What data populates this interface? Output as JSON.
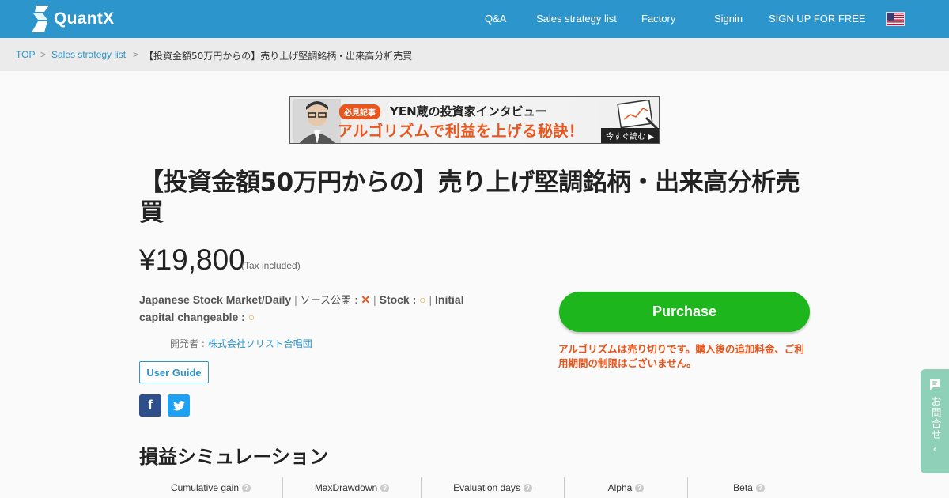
{
  "header": {
    "logo_text": "QuantX",
    "nav": [
      {
        "label": "Q&A"
      },
      {
        "label": "Sales strategy list"
      },
      {
        "label": "Factory"
      },
      {
        "label": "Signin"
      },
      {
        "label": "SIGN UP FOR FREE"
      }
    ],
    "language_flag": "us-flag-icon"
  },
  "breadcrumb": {
    "items": [
      {
        "label": "TOP"
      },
      {
        "label": "Sales strategy list"
      }
    ],
    "separator": ">",
    "current": "【投資金額50万円からの】売り上げ堅調銘柄・出来高分析売買"
  },
  "banner": {
    "tag": "必見記事",
    "subtitle": "YEN蔵の投資家インタビュー",
    "headline": "アルゴリズムで利益を上げる秘訣！",
    "cta": "今すぐ読む ▶"
  },
  "product": {
    "title": "【投資金額50万円からの】売り上げ堅調銘柄・出来高分析売買",
    "price": "¥19,800",
    "tax_note": "(Tax included)",
    "market": "Japanese Stock Market/Daily",
    "source_label": "ソース公開 :",
    "source_mark": "✕",
    "stock_label": "Stock :",
    "stock_mark": "○",
    "capital_label": "Initial capital changeable :",
    "capital_mark": "○",
    "developer_label": "開発者 :",
    "developer_name": "株式会社ソリスト合唱団",
    "user_guide": "User Guide"
  },
  "purchase": {
    "button": "Purchase",
    "note": "アルゴリズムは売り切りです。購入後の追加料金、ご利用期間の制限はございません。"
  },
  "simulation": {
    "title": "損益シミュレーション",
    "columns": [
      {
        "label": "Cumulative gain"
      },
      {
        "label": "MaxDrawdown"
      },
      {
        "label": "Evaluation days"
      },
      {
        "label": "Alpha"
      },
      {
        "label": "Beta"
      }
    ]
  },
  "contact_tab": {
    "label": "お問合せ"
  },
  "colors": {
    "header": "#2b95cc",
    "accent_orange": "#e8561d",
    "purchase_green": "#1db61d",
    "contact_tab": "#8fd0b8"
  }
}
